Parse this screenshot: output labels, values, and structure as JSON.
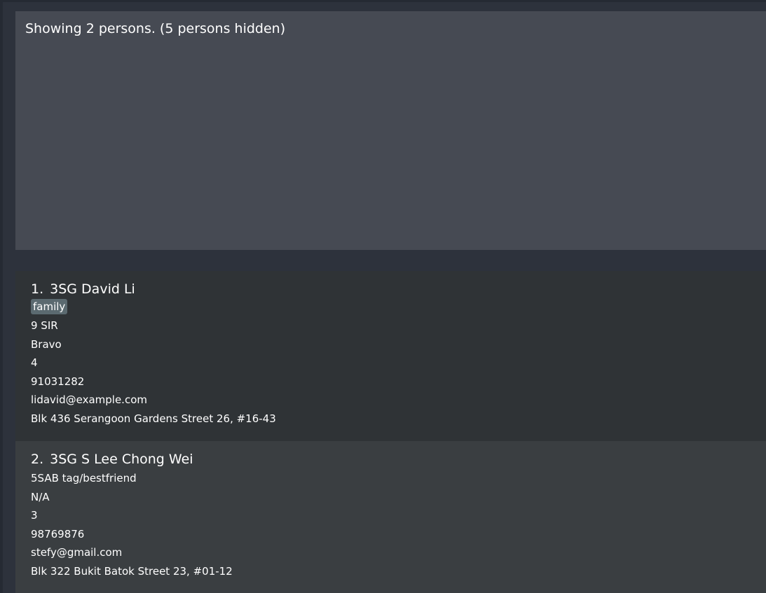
{
  "result": {
    "message": "Showing 2 persons. (5 persons hidden)"
  },
  "persons": [
    {
      "index": "1.",
      "name": "3SG David Li",
      "tag": "family",
      "fields": [
        "9 SIR",
        "Bravo",
        "4",
        "91031282",
        "lidavid@example.com",
        "Blk 436 Serangoon Gardens Street 26, #16-43"
      ]
    },
    {
      "index": "2.",
      "name": "3SG S Lee Chong Wei",
      "fields": [
        "5SAB tag/bestfriend",
        "N/A",
        "3",
        "98769876",
        "stefy@gmail.com",
        "Blk 322 Bukit Batok Street 23, #01-12"
      ]
    }
  ]
}
